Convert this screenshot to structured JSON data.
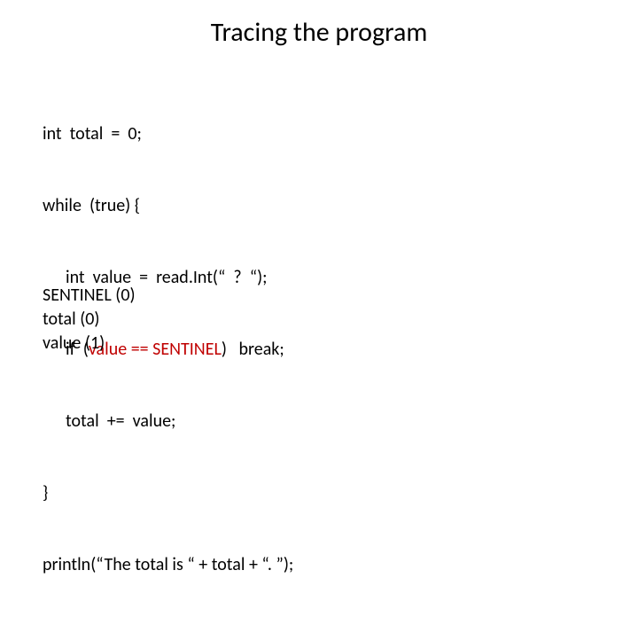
{
  "title": "Tracing the program",
  "code": {
    "l1": "int  total  =  0;",
    "l2": "while  (true) {",
    "l3": "int  value  =  read.Int(“  ?  “);",
    "l4_pre": "if  (",
    "l4_hl": "value == SENTINEL",
    "l4_post": ")   break;",
    "l5": "total  +=  value;",
    "l6": "}",
    "l7": "println(“The total is “ + total + “. ”);"
  },
  "trace": {
    "t1": "SENTINEL  (0)",
    "t2": "total  (0)",
    "t3": "value (1)"
  }
}
